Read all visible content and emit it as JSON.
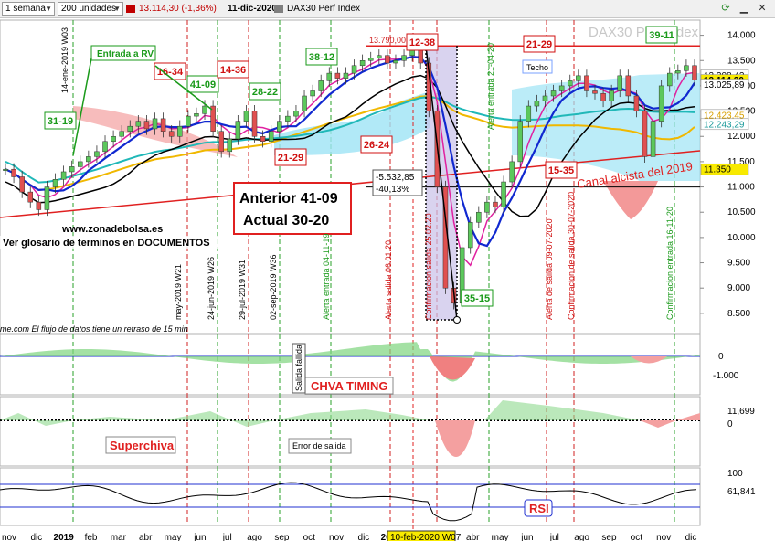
{
  "toolbar": {
    "interval": "1 semana",
    "units": "200 unidades",
    "price_change": "13.114,30 (-1,36%)",
    "date": "11-dic-2020",
    "instrument": "DAX30 Perf Index"
  },
  "chart_data": {
    "type": "line",
    "title": "DAX30 Perf Index",
    "watermark": "DAX30 Perf Index",
    "x_months": [
      "nov",
      "dic",
      "2019",
      "feb",
      "mar",
      "abr",
      "may",
      "jun",
      "jul",
      "ago",
      "sep",
      "oct",
      "nov",
      "dic",
      "2020",
      "feb",
      "mar",
      "abr",
      "may",
      "jun",
      "jul",
      "ago",
      "sep",
      "oct",
      "nov",
      "dic"
    ],
    "cursor_label": "10-feb-2020 W07",
    "main_panel": {
      "y_ticks": [
        "14.000",
        "13.500",
        "13.000",
        "12.500",
        "12.000",
        "11.500",
        "11.000",
        "10.500",
        "10.000",
        "9.500",
        "9.000",
        "8.500"
      ],
      "ylim": [
        8100,
        14300
      ],
      "price_weekly": [
        11350,
        11200,
        10900,
        10700,
        10550,
        11000,
        11150,
        11300,
        11400,
        11500,
        11600,
        11700,
        11900,
        12000,
        12100,
        12200,
        12300,
        12150,
        12350,
        12100,
        12000,
        12200,
        12400,
        12450,
        12600,
        12100,
        11700,
        11950,
        12300,
        12500,
        12000,
        11900,
        12100,
        12300,
        12400,
        12500,
        12800,
        12900,
        13100,
        13250,
        13150,
        13250,
        13400,
        13500,
        13550,
        13600,
        13450,
        13500,
        13600,
        13750,
        13450,
        12500,
        11000,
        9000,
        8700,
        9800,
        10300,
        10500,
        10700,
        10600,
        11100,
        11500,
        12300,
        12600,
        12700,
        12800,
        12900,
        13000,
        13100,
        13200,
        12900,
        12850,
        12700,
        12900,
        13200,
        12800,
        12500,
        11600,
        12300,
        13000,
        13250,
        13300,
        13400,
        13114
      ],
      "price_levels": [
        {
          "label": "13.208,42",
          "value": 13208
        },
        {
          "label": "13.114,30",
          "value": 13114
        },
        {
          "label": "13.025,89",
          "value": 13026
        },
        {
          "label": "12.423,45",
          "value": 12423
        },
        {
          "label": "12.243,29",
          "value": 12243
        },
        {
          "label": "11.350",
          "value": 11350
        }
      ],
      "resistance_label": "13.790,00",
      "resistance": 13790,
      "annotations": {
        "entrada": "Entrada a RV",
        "canal": "Canal alcista del 2019",
        "techo": "Techo",
        "anterior": "Anterior 41-09",
        "actual": "Actual  30-20",
        "website": "www.zonadebolsa.es",
        "glosario": "Ver glosario de terminos en DOCUMENTOS",
        "drop_value": "-5.532,85",
        "drop_pct": "-40,13%",
        "delay_note": "me.com  El flujo de datos tiene un retraso de 15 min"
      },
      "boxes": [
        {
          "text": "31-19",
          "color": "green"
        },
        {
          "text": "16-34",
          "color": "red"
        },
        {
          "text": "41-09",
          "color": "green"
        },
        {
          "text": "14-36",
          "color": "red"
        },
        {
          "text": "28-22",
          "color": "green"
        },
        {
          "text": "21-29",
          "color": "red"
        },
        {
          "text": "38-12",
          "color": "green"
        },
        {
          "text": "26-24",
          "color": "red"
        },
        {
          "text": "12-38",
          "color": "red"
        },
        {
          "text": "21-29",
          "color": "red"
        },
        {
          "text": "15-35",
          "color": "red"
        },
        {
          "text": "39-11",
          "color": "green"
        },
        {
          "text": "35-15",
          "color": "green"
        }
      ],
      "vertical_labels": [
        "14-ene-2019 W03",
        "may-2019 W21",
        "24-jun-2019 W26",
        "29-jul-2019 W31",
        "02-sep-2019 W36",
        "Alerta entrada 04-11-19",
        "Alerta salida 06.01.20",
        "Confirmacion salida 25.02.20",
        "Alerta entrada 21-04-20",
        "Alerta de salida 09-07-2020",
        "Confirmacion de salida 30-07-2020",
        "Confirmacion entrada 16-11-20"
      ]
    },
    "chva_panel": {
      "title": "CHVA TIMING",
      "y_ticks": [
        "0",
        "-1.000"
      ],
      "label_salida": "Salida fallida"
    },
    "superchiva_panel": {
      "title": "Superchiva",
      "note": "Error de salida",
      "y_ticks": [
        "11,699",
        "0"
      ]
    },
    "rsi_panel": {
      "title": "RSI",
      "y_ticks": [
        "100",
        "61,841"
      ]
    }
  }
}
